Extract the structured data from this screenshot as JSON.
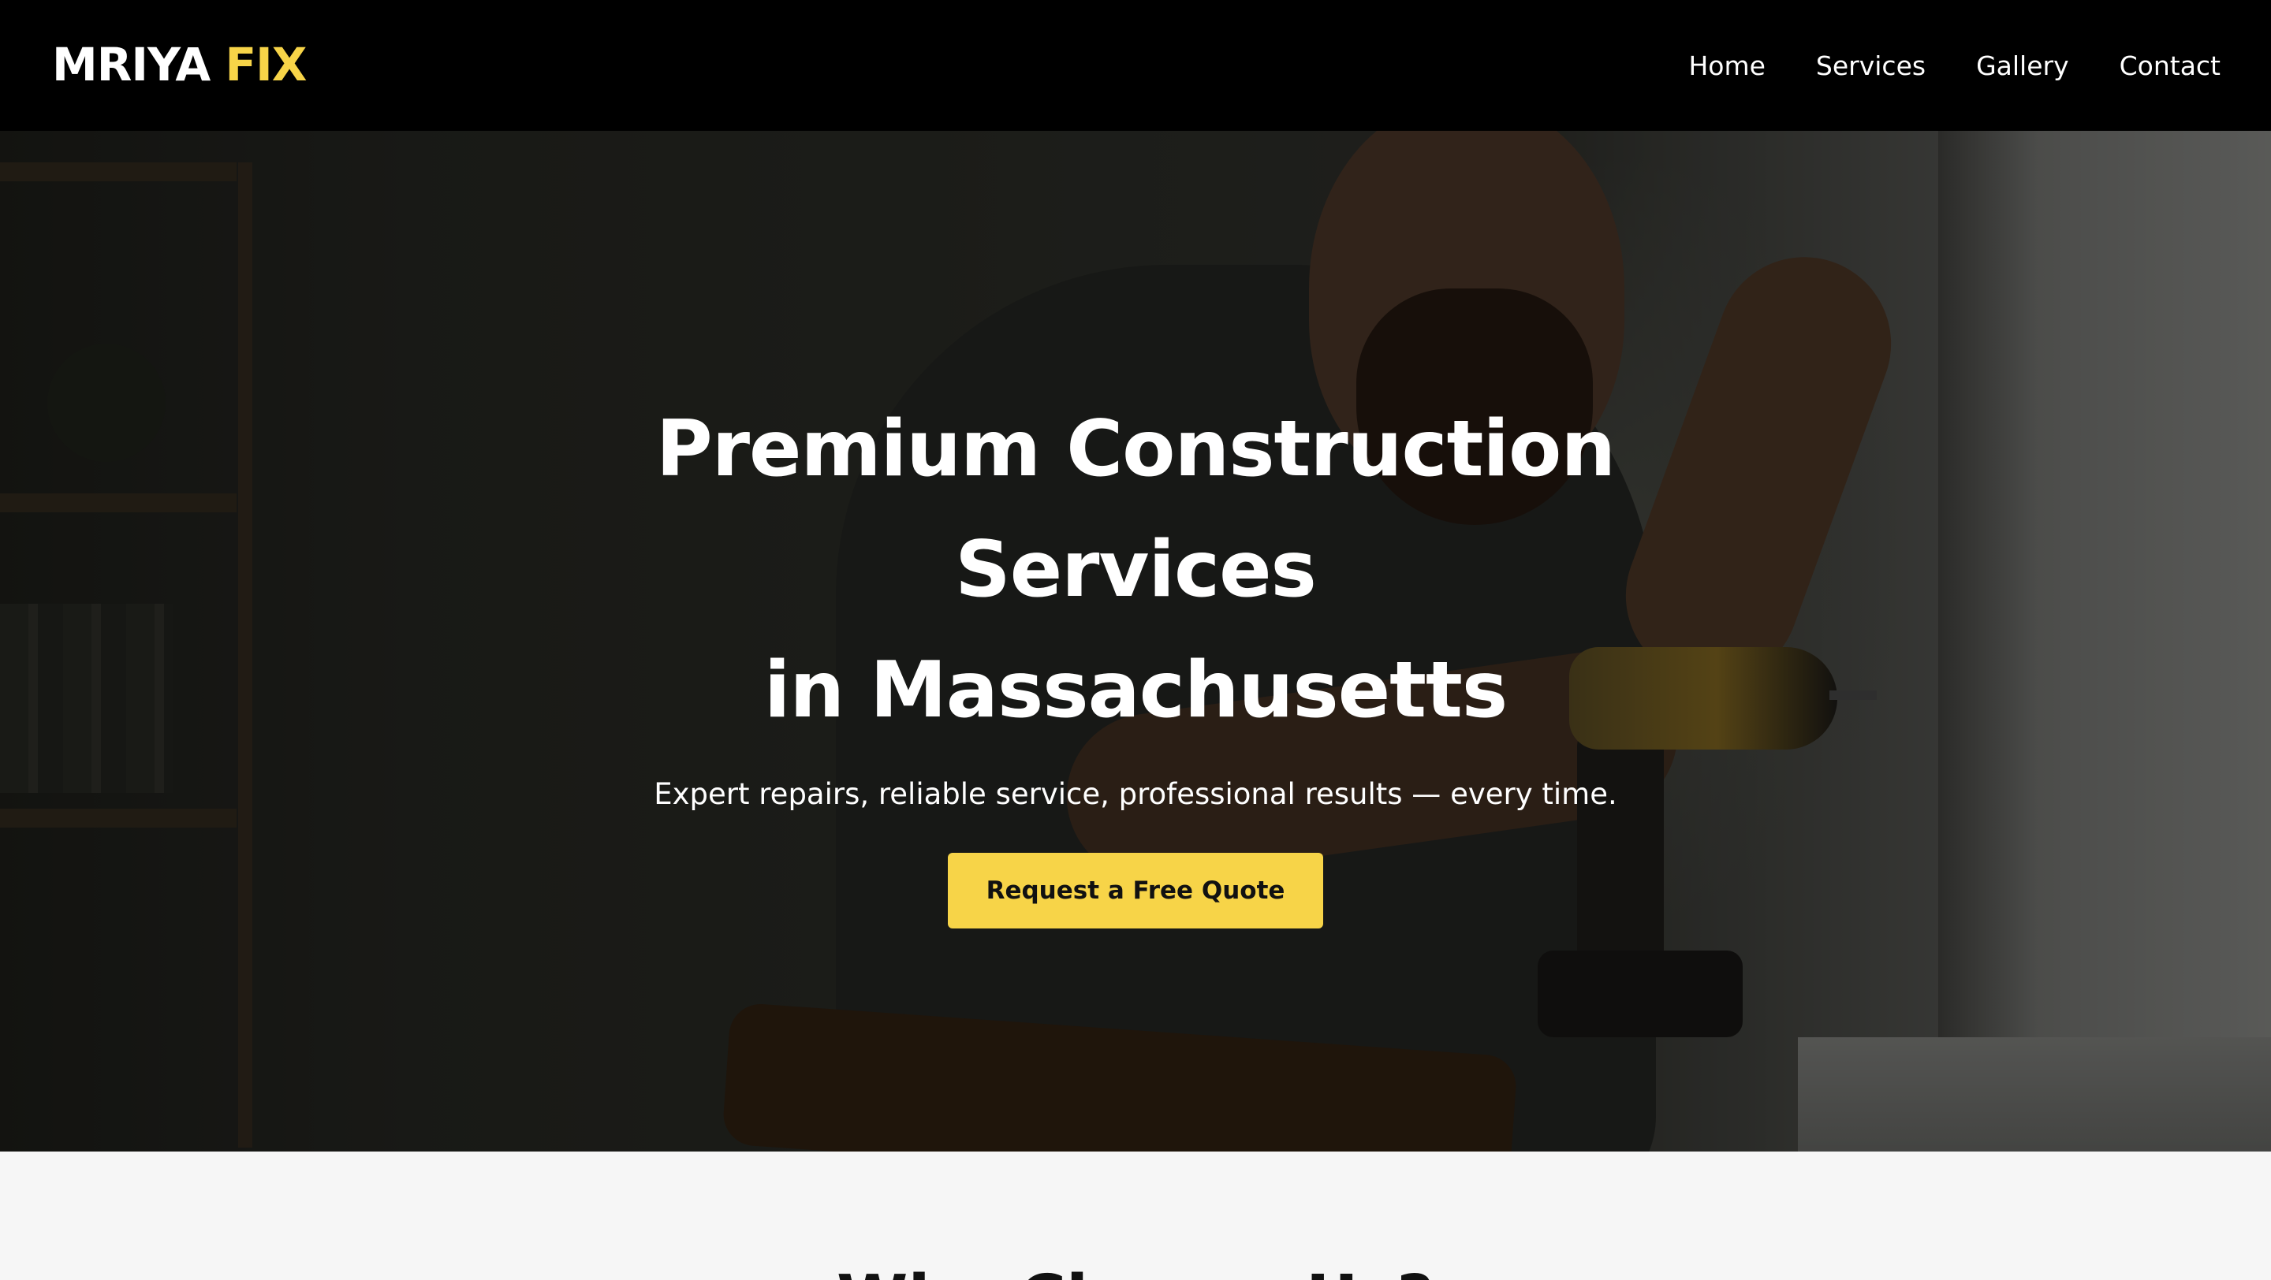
{
  "header": {
    "logo_main": "MRIYA",
    "logo_accent": "FIX",
    "nav": [
      {
        "label": "Home"
      },
      {
        "label": "Services"
      },
      {
        "label": "Gallery"
      },
      {
        "label": "Contact"
      }
    ]
  },
  "hero": {
    "title_lines": [
      "Premium Construction",
      "Services",
      "in Massachusetts"
    ],
    "subtitle": "Expert repairs, reliable service, professional results — every time.",
    "cta_label": "Request a Free Quote"
  },
  "next_section": {
    "heading": "Why Choose Us?"
  },
  "colors": {
    "accent": "#f7d448",
    "header_bg": "#000000",
    "section_bg": "#f6f6f6"
  }
}
